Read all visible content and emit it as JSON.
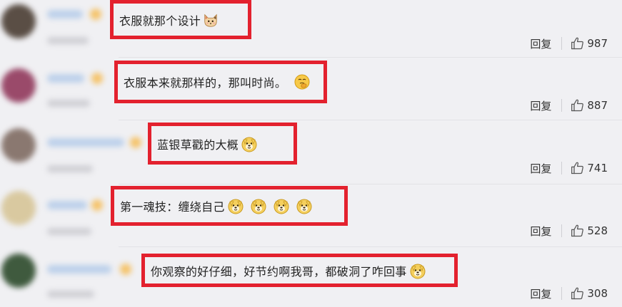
{
  "comments": [
    {
      "text": "衣服就那个设计",
      "emojis": [
        "cat-face-icon"
      ],
      "reply": "回复",
      "likes": "987",
      "avatar_color": "#5a4e45"
    },
    {
      "text": "衣服本来就那样的，那叫时尚。",
      "emojis": [
        "thinking-face-icon"
      ],
      "reply": "回复",
      "likes": "887",
      "avatar_color": "#9a4a6a"
    },
    {
      "text": "蓝银草戳的大概",
      "emojis": [
        "doge-face-icon"
      ],
      "reply": "回复",
      "likes": "741",
      "avatar_color": "#8a7870"
    },
    {
      "text": "第一魂技：缠绕自己",
      "emojis": [
        "doge-face-icon",
        "doge-face-icon",
        "doge-face-icon",
        "doge-face-icon"
      ],
      "reply": "回复",
      "likes": "528",
      "avatar_color": "#d9c9a0"
    },
    {
      "text": "你观察的好仔细，好节约啊我哥，都破洞了咋回事",
      "emojis": [
        "doge-face-icon"
      ],
      "reply": "回复",
      "likes": "308",
      "avatar_color": "#3f5a3e"
    }
  ],
  "colors": {
    "highlight_border": "#e3212e",
    "background": "#f0f0f3",
    "emoji_yellow": "#f7c948"
  }
}
